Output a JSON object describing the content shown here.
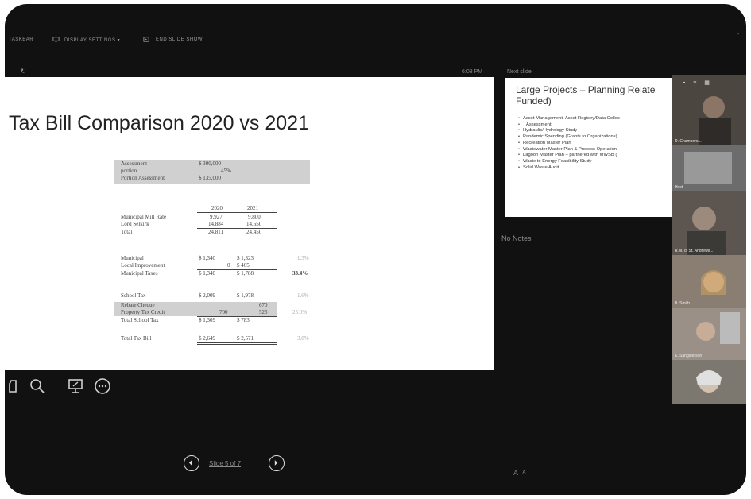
{
  "toolbar": {
    "items": [
      {
        "label": "TASKBAR",
        "icon": "taskbar-icon"
      },
      {
        "label": "DISPLAY SETTINGS ▾",
        "icon": "display-settings-icon"
      },
      {
        "label": "END SLIDE SHOW",
        "icon": "end-slideshow-icon"
      }
    ]
  },
  "presenter": {
    "time": "6:08 PM",
    "next_slide_label": "Next slide",
    "notes": "No Notes"
  },
  "slide": {
    "title": "Tax Bill Comparison 2020 vs 2021",
    "assessment": [
      {
        "label": "Assessment",
        "value": "$ 300,000"
      },
      {
        "label": "portion",
        "value": "45%"
      },
      {
        "label": "Portion Assessment",
        "value": "$ 135,000"
      }
    ],
    "mill": {
      "headers": [
        "2020",
        "2021"
      ],
      "rows": [
        {
          "label": "Municipal Mill Rate",
          "v2020": "9.927",
          "v2021": "9.800"
        },
        {
          "label": "Lord Selkirk",
          "v2020": "14.884",
          "v2021": "14.650"
        },
        {
          "label": "Total",
          "v2020": "24.811",
          "v2021": "24.450"
        }
      ]
    },
    "municipal": [
      {
        "label": "Municipal",
        "v2020": "$ 1,340",
        "v2021": "$ 1,323",
        "pct": "1.3%"
      },
      {
        "label": "Local Improvement",
        "v2020": "0",
        "v2021": "$   465",
        "pct": ""
      },
      {
        "label": "Municipal Taxes",
        "v2020": "$ 1,340",
        "v2021": "$ 1,788",
        "pct": "33.4%"
      }
    ],
    "school": [
      {
        "label": "School Tax",
        "v2020": "$ 2,009",
        "v2021": "$ 1,978",
        "pct": "1.6%"
      },
      {
        "label": "Rebate Cheque",
        "v2020": "",
        "v2021": "670",
        "pct": ""
      },
      {
        "label": "Property Tax Credit",
        "v2020": "700",
        "v2021": "525",
        "pct": "25.0%"
      },
      {
        "label": "Total School Tax",
        "v2020": "$ 1,309",
        "v2021": "$   783",
        "pct": ""
      }
    ],
    "total": {
      "label": "Total Tax Bill",
      "v2020": "$ 2,649",
      "v2021": "$ 2,571",
      "pct": "3.0%"
    }
  },
  "next_slide": {
    "title": "Large Projects – Planning Relate Funded)",
    "bullets": [
      "Asset Management, Asset Registry/Data Collec",
      "Assessment",
      "Hydraulic/Hydrology Study",
      "Pandemic Spending (Grants to Organizations)",
      "Recreation Master Plan",
      "Wastewater Master Plan & Process Operation",
      "Lagoon Master Plan – partnered with MWSB (",
      "Waste to Energy Feasibility Study",
      "Solid Waste Audit"
    ]
  },
  "navigation": {
    "slide_counter": "Slide 5 of 7"
  },
  "participants": [
    {
      "name": "D. Chambers...",
      "tone": "#6b6358"
    },
    {
      "name": "Host",
      "tone": "#7a7a7a"
    },
    {
      "name": "R.M. of St. Andrews...",
      "tone": "#5d5650"
    },
    {
      "name": "B. Smith",
      "tone": "#8a7e72"
    },
    {
      "name": "E. Sangsterson",
      "tone": "#9a9088"
    },
    {
      "name": "",
      "tone": "#7c776f"
    }
  ],
  "colors": {
    "frame": "#111111",
    "slide_bg": "#ffffff",
    "muted_text": "#8a8a8a",
    "table_shade": "#d0d0d0"
  }
}
